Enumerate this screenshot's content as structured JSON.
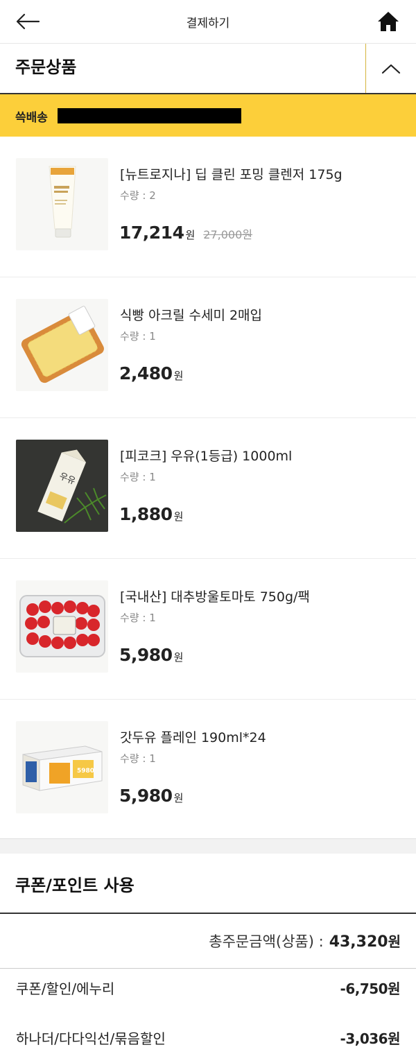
{
  "header": {
    "title": "결제하기",
    "back_icon": "back-arrow-icon",
    "home_icon": "home-icon"
  },
  "order": {
    "section_title": "주문상품",
    "collapse_icon": "chevron-up-icon",
    "delivery_label": "쓱배송",
    "accent_color": "#fccf3a"
  },
  "products": [
    {
      "name": "[뉴트로지나] 딥 클린 포밍 클렌저 175g",
      "qty": "수량 : 2",
      "price": "17,214",
      "won": "원",
      "original_price": "27,000원",
      "image": "cleanser-tube-image"
    },
    {
      "name": "식빵 아크릴 수세미 2매입",
      "qty": "수량 : 1",
      "price": "2,480",
      "won": "원",
      "original_price": "",
      "image": "bread-scrubber-image"
    },
    {
      "name": "[피코크] 우유(1등급) 1000ml",
      "qty": "수량 : 1",
      "price": "1,880",
      "won": "원",
      "original_price": "",
      "image": "milk-carton-image"
    },
    {
      "name": "[국내산] 대추방울토마토 750g/팩",
      "qty": "수량 : 1",
      "price": "5,980",
      "won": "원",
      "original_price": "",
      "image": "cherry-tomato-pack-image"
    },
    {
      "name": "갓두유 플레인 190ml*24",
      "qty": "수량 : 1",
      "price": "5,980",
      "won": "원",
      "original_price": "",
      "image": "soymilk-box-image"
    }
  ],
  "coupon": {
    "section_title": "쿠폰/포인트 사용",
    "total_label": "총주문금액(상품) :",
    "total_amount": "43,320",
    "total_won": "원",
    "discounts": [
      {
        "label": "쿠폰/할인/에누리",
        "value": "-6,750원"
      },
      {
        "label": "하나더/다다익선/묶음할인",
        "value": "-3,036원"
      }
    ]
  }
}
